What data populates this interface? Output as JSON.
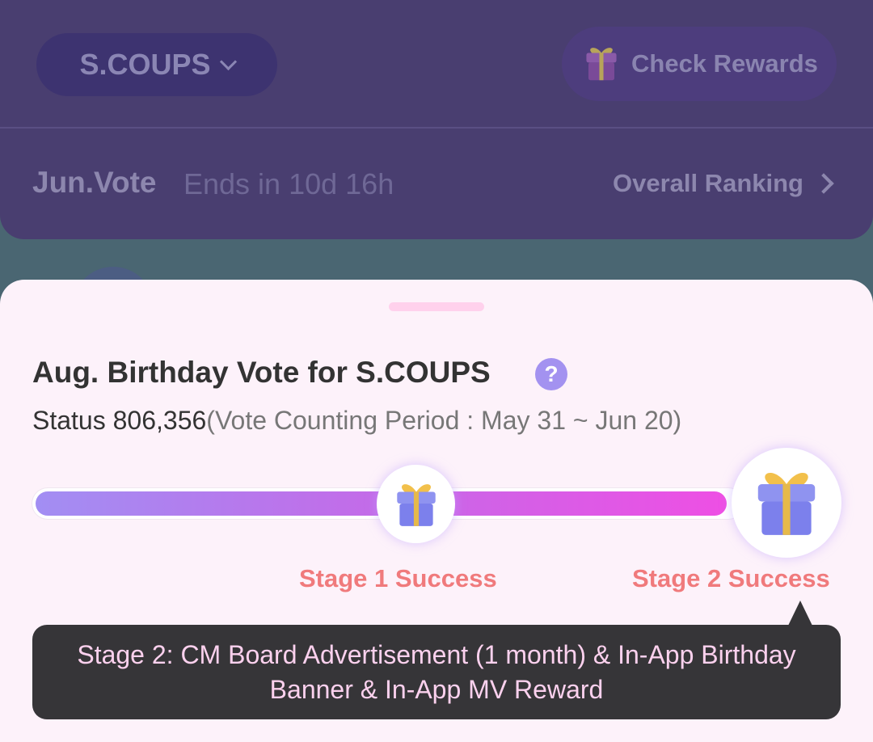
{
  "header": {
    "member_name": "S.COUPS",
    "check_rewards_label": "Check Rewards"
  },
  "vote": {
    "title": "Jun.Vote",
    "ends": "Ends in 10d 16h",
    "ranking_label": "Overall Ranking"
  },
  "sheet": {
    "title": "Aug. Birthday Vote for S.COUPS",
    "help_symbol": "?",
    "status_label": "Status 806,356",
    "period": "(Vote Counting Period : May 31 ~ Jun 20)",
    "progress_fraction": 0.98,
    "stages": [
      {
        "label": "Stage 1 Success"
      },
      {
        "label": "Stage 2 Success"
      }
    ],
    "tooltip": "Stage 2: CM Board Advertisement (1 month) & In-App Birthday Banner & In-App MV Reward"
  },
  "colors": {
    "accent_purple": "#a392f0",
    "stage_success": "#f07a7c",
    "progress_start": "#a28ef3",
    "progress_end": "#ee4fe4",
    "tooltip_bg": "#363538",
    "tooltip_text": "#fcd1ee"
  },
  "icons": {
    "gift": "gift-icon",
    "help": "question-circle-icon",
    "chevron_down": "chevron-down-icon",
    "chevron_right": "chevron-right-icon"
  }
}
